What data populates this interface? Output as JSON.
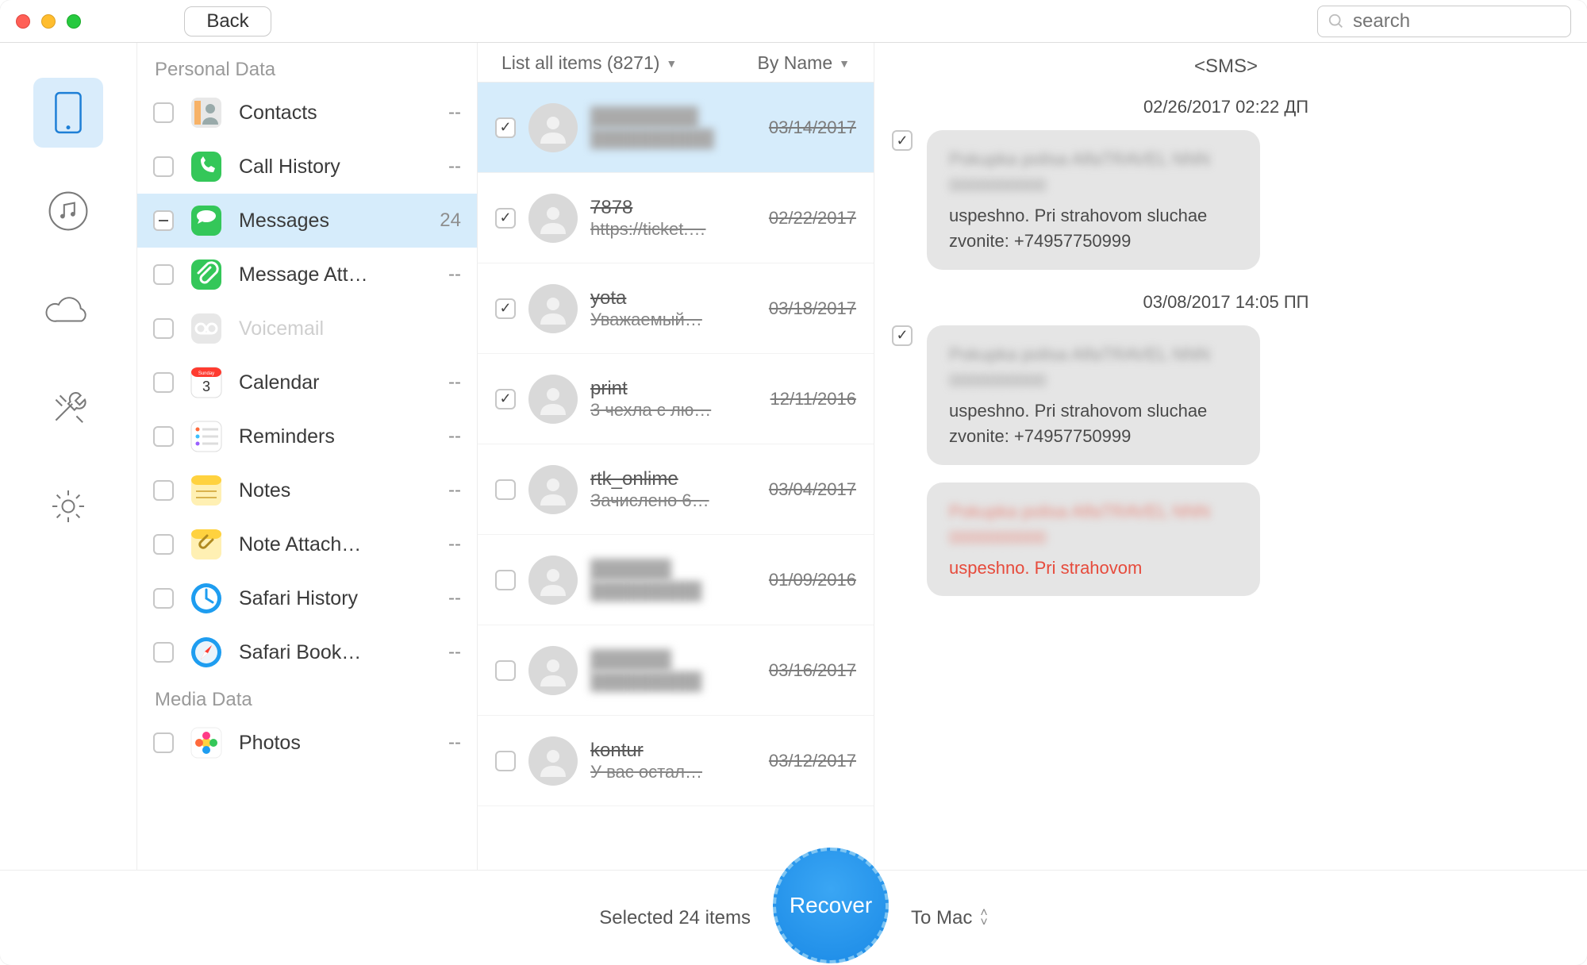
{
  "titlebar": {
    "back": "Back",
    "search_placeholder": "search"
  },
  "sections": {
    "personal": "Personal Data",
    "media": "Media Data"
  },
  "categories": [
    {
      "icon": "contacts",
      "label": "Contacts",
      "count": "--"
    },
    {
      "icon": "callhistory",
      "label": "Call History",
      "count": "--"
    },
    {
      "icon": "messages",
      "label": "Messages",
      "count": "24",
      "selected": true,
      "check": "minus"
    },
    {
      "icon": "attach",
      "label": "Message Att…",
      "count": "--"
    },
    {
      "icon": "voicemail",
      "label": "Voicemail",
      "count": "",
      "disabled": true
    },
    {
      "icon": "calendar",
      "label": "Calendar",
      "count": "--"
    },
    {
      "icon": "reminders",
      "label": "Reminders",
      "count": "--"
    },
    {
      "icon": "notes",
      "label": "Notes",
      "count": "--"
    },
    {
      "icon": "notesattach",
      "label": "Note Attach…",
      "count": "--"
    },
    {
      "icon": "safarihist",
      "label": "Safari History",
      "count": "--"
    },
    {
      "icon": "safaribook",
      "label": "Safari Book…",
      "count": "--"
    }
  ],
  "media_categories": [
    {
      "icon": "photos",
      "label": "Photos",
      "count": "--"
    }
  ],
  "threads_header": {
    "filter": "List all items (8271)",
    "sort": "By Name"
  },
  "threads": [
    {
      "checked": true,
      "name": "████████",
      "preview": "██████████",
      "date": "03/14/2017",
      "blur": true,
      "selected": true
    },
    {
      "checked": true,
      "name": "7878",
      "preview": "https://ticket.…",
      "date": "02/22/2017"
    },
    {
      "checked": true,
      "name": "yota",
      "preview": "Уважаемый…",
      "date": "03/18/2017"
    },
    {
      "checked": true,
      "name": "print",
      "preview": "3 чехла с лю…",
      "date": "12/11/2016"
    },
    {
      "checked": false,
      "name": "rtk_onlime",
      "preview": "Зачислено 6…",
      "date": "03/04/2017"
    },
    {
      "checked": false,
      "name": "██████",
      "preview": "█████████",
      "date": "01/09/2016",
      "blur": true
    },
    {
      "checked": false,
      "name": "██████",
      "preview": "█████████",
      "date": "03/16/2017",
      "blur": true
    },
    {
      "checked": false,
      "name": "kontur",
      "preview": "У вас остал…",
      "date": "03/12/2017"
    }
  ],
  "detail": {
    "title": "<SMS>",
    "groups": [
      {
        "stamp": "02/26/2017 02:22 ДП",
        "checked": true,
        "blurhead": "Pokupka polisa AlfaTRAVEL NNN 0000000000",
        "text": "uspeshno. Pri strahovom sluchae zvonite: +74957750999",
        "red": false
      },
      {
        "stamp": "03/08/2017 14:05 ПП",
        "checked": true,
        "blurhead": "Pokupka polisa AlfaTRAVEL NNN 0000000000",
        "text": "uspeshno. Pri strahovom sluchae zvonite: +74957750999",
        "red": false
      },
      {
        "stamp": "",
        "checked": false,
        "blurhead": "Pokupka polisa AlfaTRAVEL NNN 0000000000",
        "text": "uspeshno. Pri strahovom",
        "red": true,
        "partial": true
      }
    ]
  },
  "footer": {
    "selected": "Selected 24 items",
    "recover": "Recover",
    "dest": "To Mac"
  }
}
